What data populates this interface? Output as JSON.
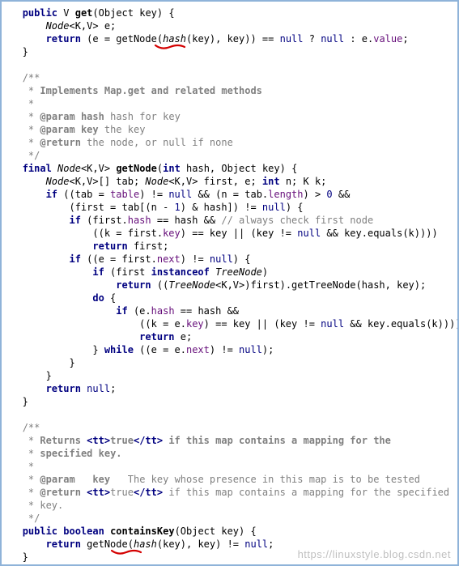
{
  "watermark": "https://linuxstyle.blog.csdn.net",
  "code": {
    "l1": "public V get(Object key) {",
    "l2": "    Node<K,V> e;",
    "l3": "    return (e = getNode(hash(key), key)) == null ? null : e.value;",
    "l4": "}",
    "l5": "",
    "l6": "/**",
    "l7": " * Implements Map.get and related methods",
    "l8": " *",
    "l9": " * @param hash hash for key",
    "l10": " * @param key the key",
    "l11": " * @return the node, or null if none",
    "l12": " */",
    "l13": "final Node<K,V> getNode(int hash, Object key) {",
    "l14": "    Node<K,V>[] tab; Node<K,V> first, e; int n; K k;",
    "l15": "    if ((tab = table) != null && (n = tab.length) > 0 &&",
    "l16": "        (first = tab[(n - 1) & hash]) != null) {",
    "l17": "        if (first.hash == hash && // always check first node",
    "l18": "            ((k = first.key) == key || (key != null && key.equals(k))))",
    "l19": "            return first;",
    "l20": "        if ((e = first.next) != null) {",
    "l21": "            if (first instanceof TreeNode)",
    "l22": "                return ((TreeNode<K,V>)first).getTreeNode(hash, key);",
    "l23": "            do {",
    "l24": "                if (e.hash == hash &&",
    "l25": "                    ((k = e.key) == key || (key != null && key.equals(k))))",
    "l26": "                    return e;",
    "l27": "            } while ((e = e.next) != null);",
    "l28": "        }",
    "l29": "    }",
    "l30": "    return null;",
    "l31": "}",
    "l32": "",
    "l33": "/**",
    "l34": " * Returns <tt>true</tt> if this map contains a mapping for the",
    "l35": " * specified key.",
    "l36": " *",
    "l37": " * @param   key   The key whose presence in this map is to be tested",
    "l38": " * @return <tt>true</tt> if this map contains a mapping for the specified",
    "l39": " * key.",
    "l40": " */",
    "l41": "public boolean containsKey(Object key) {",
    "l42": "    return getNode(hash(key), key) != null;",
    "l43": "}"
  }
}
